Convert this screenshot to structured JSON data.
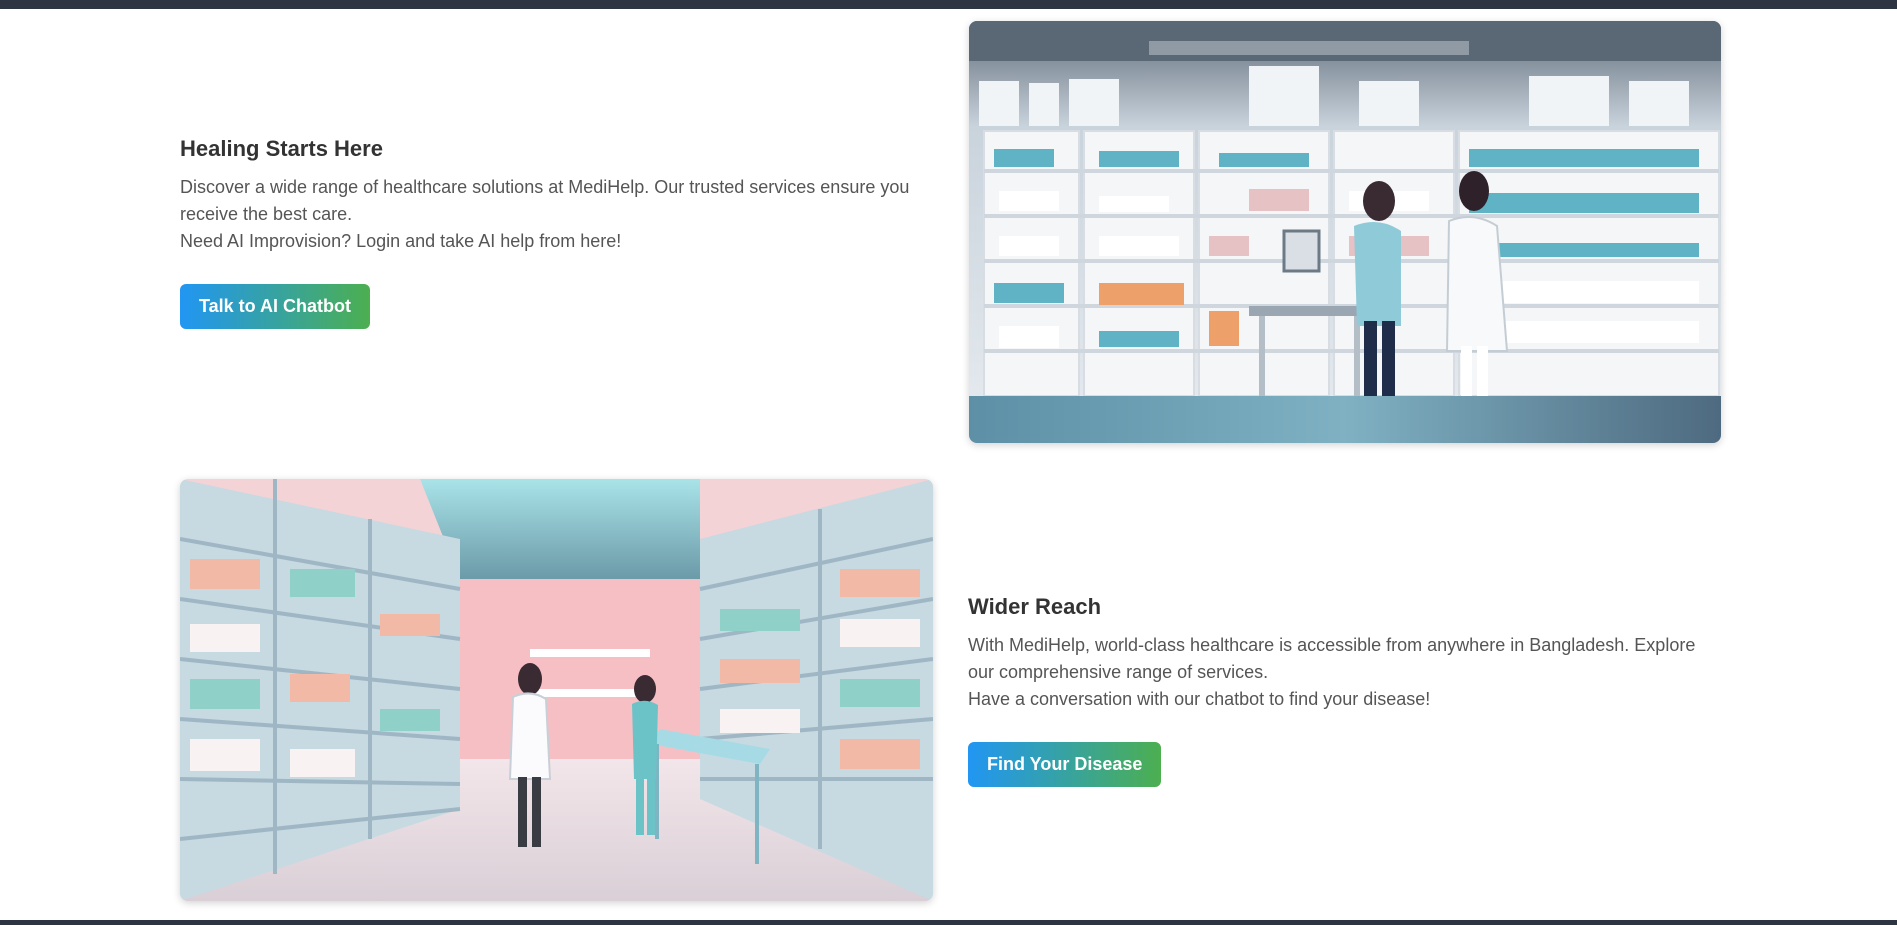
{
  "sections": [
    {
      "title": "Healing Starts Here",
      "body1": "Discover a wide range of healthcare solutions at MediHelp. Our trusted services ensure you receive the best care.",
      "body2": "Need AI Improvision? Login and take AI help from here!",
      "button_label": "Talk to AI Chatbot"
    },
    {
      "title": "Wider Reach",
      "body1": "With MediHelp, world-class healthcare is accessible from anywhere in Bangladesh. Explore our comprehensive range of services.",
      "body2": "Have a conversation with our chatbot to find your disease!",
      "button_label": "Find Your Disease"
    }
  ],
  "colors": {
    "header_bar": "#2c3541",
    "button_gradient_start": "#2196f3",
    "button_gradient_end": "#4caf50"
  }
}
